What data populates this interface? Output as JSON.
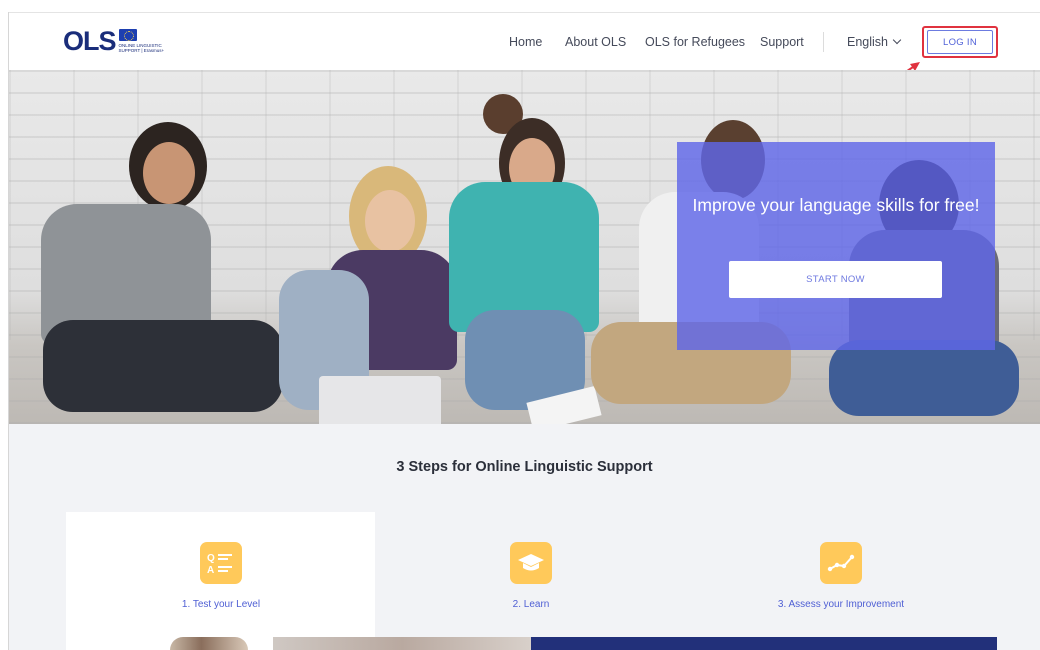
{
  "header": {
    "logo_text": "OLS",
    "logo_subtitle": "ONLINE LINGUISTIC SUPPORT | Erasmus+",
    "nav": [
      {
        "label": "Home"
      },
      {
        "label": "About OLS"
      },
      {
        "label": "OLS for Refugees"
      },
      {
        "label": "Support"
      }
    ],
    "language": "English",
    "login_label": "LOG IN"
  },
  "hero": {
    "headline": "Improve your language skills for free!",
    "cta_label": "START NOW"
  },
  "steps": {
    "title": "3 Steps for Online Linguistic Support",
    "items": [
      {
        "label": "1. Test your Level",
        "icon": "quiz-icon"
      },
      {
        "label": "2. Learn",
        "icon": "graduation-cap-icon"
      },
      {
        "label": "3. Assess your Improvement",
        "icon": "progress-chart-icon"
      }
    ]
  },
  "colors": {
    "accent": "#5162d8",
    "highlight_red": "#e0323f",
    "cta_overlay": "#5f67e8",
    "step_icon_bg": "#ffc95a",
    "brand_navy": "#1a2d7a"
  }
}
